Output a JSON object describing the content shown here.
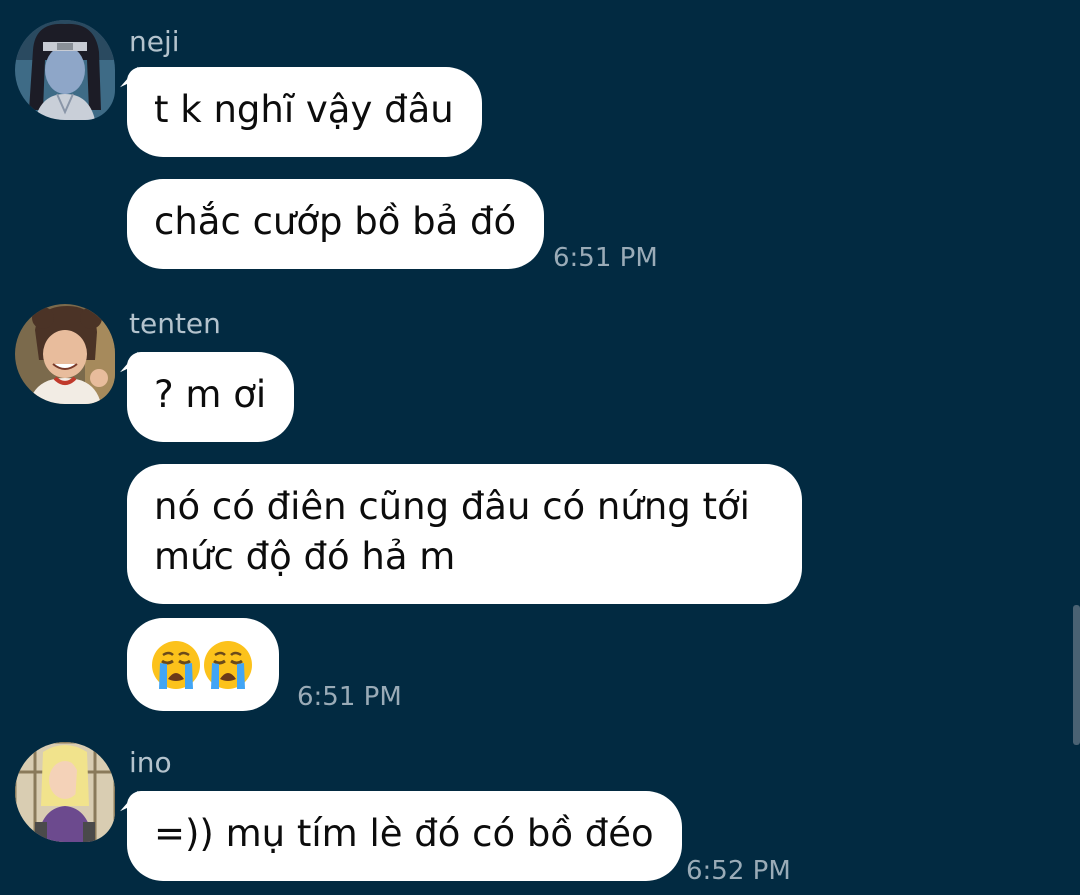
{
  "groups": [
    {
      "sender": "neji",
      "avatar": "neji-avatar",
      "messages": [
        "t k nghĩ vậy đâu",
        "chắc cướp bồ bả đó"
      ],
      "time": "6:51 PM"
    },
    {
      "sender": "tenten",
      "avatar": "tenten-avatar",
      "messages": [
        "? m ơi",
        "nó có điên cũng đâu có nứng tới mức độ đó hả m",
        "crying-face-emoji x2"
      ],
      "time": "6:51 PM"
    },
    {
      "sender": "ino",
      "avatar": "ino-avatar",
      "messages": [
        "=)) mụ tím lè đó có bồ đéo"
      ],
      "time": "6:52 PM"
    }
  ],
  "colors": {
    "background": "#022a41",
    "bubble": "#ffffff",
    "sender_name": "#b4c3cd",
    "timestamp": "#9aabb7"
  }
}
